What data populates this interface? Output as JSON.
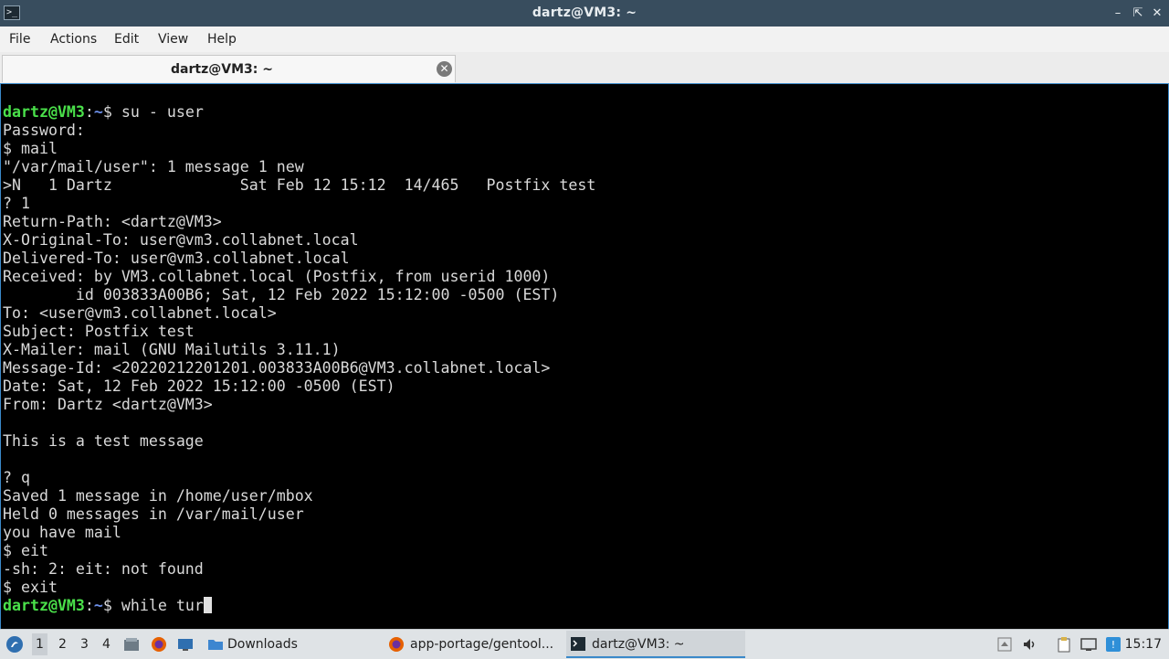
{
  "window": {
    "title": "dartz@VM3: ~",
    "app_icon_glyph": ">_",
    "controls": [
      "minimize",
      "maximize",
      "close"
    ]
  },
  "menubar": {
    "items": [
      "File",
      "Actions",
      "Edit",
      "View",
      "Help"
    ]
  },
  "tabs": [
    {
      "label": "dartz@VM3: ~",
      "active": true
    }
  ],
  "terminal": {
    "prompt": {
      "user_host": "dartz@VM3",
      "sep": ":",
      "path": "~",
      "symbol": "$ "
    },
    "lines": [
      {
        "prompt": true,
        "text": "su - user"
      },
      {
        "text": "Password:"
      },
      {
        "text": "$ mail"
      },
      {
        "text": "\"/var/mail/user\": 1 message 1 new"
      },
      {
        "text": ">N   1 Dartz              Sat Feb 12 15:12  14/465   Postfix test"
      },
      {
        "text": "? 1"
      },
      {
        "text": "Return-Path: <dartz@VM3>"
      },
      {
        "text": "X-Original-To: user@vm3.collabnet.local"
      },
      {
        "text": "Delivered-To: user@vm3.collabnet.local"
      },
      {
        "text": "Received: by VM3.collabnet.local (Postfix, from userid 1000)"
      },
      {
        "text": "        id 003833A00B6; Sat, 12 Feb 2022 15:12:00 -0500 (EST)"
      },
      {
        "text": "To: <user@vm3.collabnet.local>"
      },
      {
        "text": "Subject: Postfix test"
      },
      {
        "text": "X-Mailer: mail (GNU Mailutils 3.11.1)"
      },
      {
        "text": "Message-Id: <20220212201201.003833A00B6@VM3.collabnet.local>"
      },
      {
        "text": "Date: Sat, 12 Feb 2022 15:12:00 -0500 (EST)"
      },
      {
        "text": "From: Dartz <dartz@VM3>"
      },
      {
        "text": ""
      },
      {
        "text": "This is a test message"
      },
      {
        "text": ""
      },
      {
        "text": "? q"
      },
      {
        "text": "Saved 1 message in /home/user/mbox"
      },
      {
        "text": "Held 0 messages in /var/mail/user"
      },
      {
        "text": "you have mail"
      },
      {
        "text": "$ eit"
      },
      {
        "text": "-sh: 2: eit: not found"
      },
      {
        "text": "$ exit"
      },
      {
        "prompt": true,
        "text": "while tur",
        "cursor": true
      }
    ]
  },
  "taskbar": {
    "workspaces": [
      "1",
      "2",
      "3",
      "4"
    ],
    "active_workspace": "1",
    "tasks": [
      {
        "label": "Downloads",
        "icon": "folder-icon"
      },
      {
        "label": "app-portage/gentool...",
        "icon": "firefox-icon"
      },
      {
        "label": "dartz@VM3: ~",
        "icon": "terminal-icon",
        "current": true
      }
    ],
    "clock": "15:17"
  },
  "colors": {
    "titlebar": "#384d5e",
    "terminal_bg": "#000000",
    "prompt_user": "#4ae04a",
    "prompt_path": "#6c8fe8",
    "accent": "#3a89c9"
  }
}
